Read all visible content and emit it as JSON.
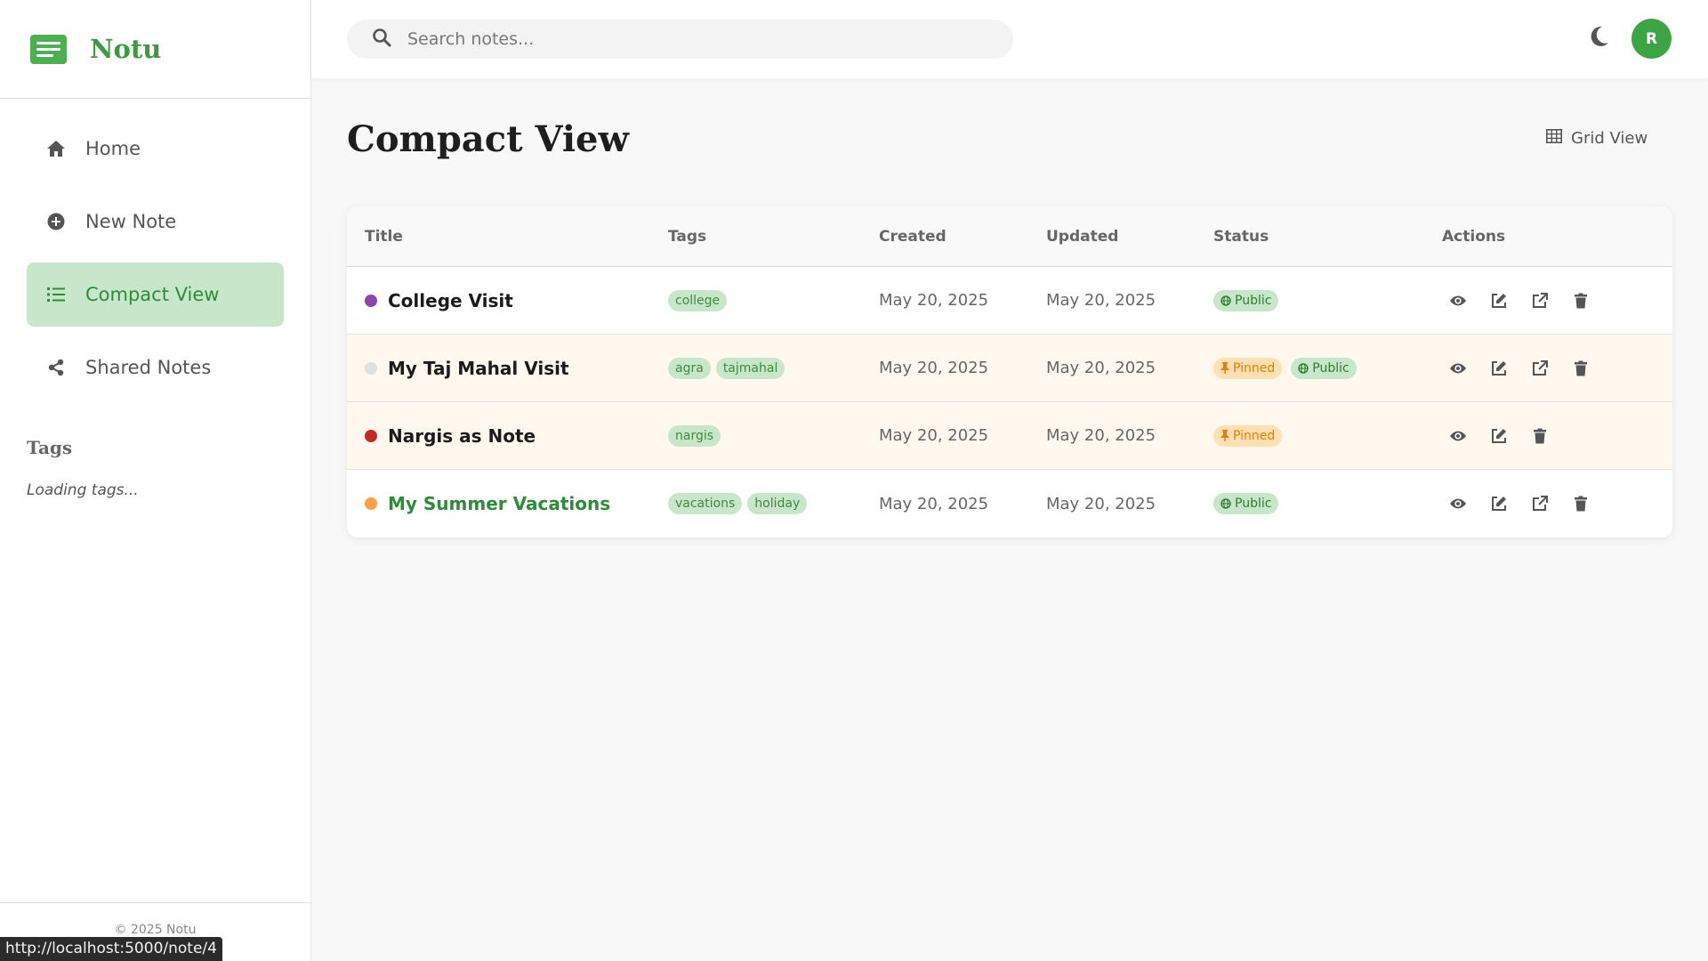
{
  "app": {
    "name": "Notu"
  },
  "sidebar": {
    "items": [
      {
        "label": "Home"
      },
      {
        "label": "New Note"
      },
      {
        "label": "Compact View"
      },
      {
        "label": "Shared Notes"
      }
    ],
    "tags_title": "Tags",
    "tags_loading": "Loading tags...",
    "footer": "© 2025 Notu"
  },
  "search": {
    "placeholder": "Search notes..."
  },
  "user": {
    "initial": "R"
  },
  "main": {
    "title": "Compact View",
    "grid_view_label": "Grid View",
    "columns": [
      "Title",
      "Tags",
      "Created",
      "Updated",
      "Status",
      "Actions"
    ],
    "rows": [
      {
        "title": "College Visit",
        "dot_color": "#8e44ad",
        "tags": [
          "college"
        ],
        "created": "May 20, 2025",
        "updated": "May 20, 2025",
        "status": [
          "Public"
        ]
      },
      {
        "title": "My Taj Mahal Visit",
        "dot_color": "#e0e0e0",
        "tags": [
          "agra",
          "tajmahal"
        ],
        "created": "May 20, 2025",
        "updated": "May 20, 2025",
        "status": [
          "Pinned",
          "Public"
        ]
      },
      {
        "title": "Nargis as Note",
        "dot_color": "#c62828",
        "tags": [
          "nargis"
        ],
        "created": "May 20, 2025",
        "updated": "May 20, 2025",
        "status": [
          "Pinned"
        ]
      },
      {
        "title": "My Summer Vacations",
        "dot_color": "#ff9f43",
        "tags": [
          "vacations",
          "holiday"
        ],
        "created": "May 20, 2025",
        "updated": "May 20, 2025",
        "status": [
          "Public"
        ]
      }
    ]
  },
  "browser_status_url": "http://localhost:5000/note/4",
  "colors": {
    "accent": "#4caf50",
    "accent_light": "#c8e6c9",
    "pinned": "#ffe0b2",
    "pinned_row": "#fff8ee"
  }
}
